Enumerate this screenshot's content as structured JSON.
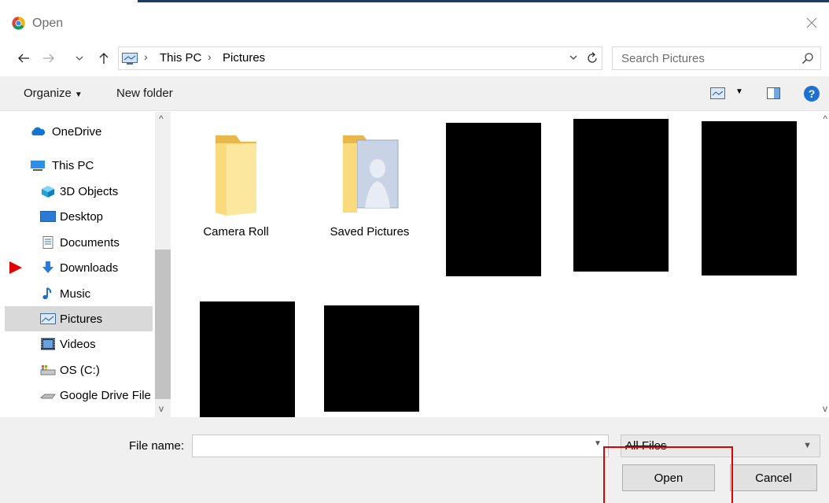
{
  "window": {
    "title": "Open",
    "icon": "chrome-icon"
  },
  "address_bar": {
    "icon": "this-pc-icon",
    "breadcrumbs": [
      "This PC",
      "Pictures"
    ],
    "search_placeholder": "Search Pictures"
  },
  "toolbar": {
    "organize_label": "Organize",
    "new_folder_label": "New folder"
  },
  "nav_pane": {
    "items": [
      {
        "label": "OneDrive",
        "icon": "onedrive-cloud-icon"
      },
      {
        "label": "This PC",
        "icon": "this-pc-icon"
      },
      {
        "label": "3D Objects",
        "icon": "3d-objects-icon"
      },
      {
        "label": "Desktop",
        "icon": "desktop-icon"
      },
      {
        "label": "Documents",
        "icon": "documents-icon"
      },
      {
        "label": "Downloads",
        "icon": "downloads-icon"
      },
      {
        "label": "Music",
        "icon": "music-icon"
      },
      {
        "label": "Pictures",
        "icon": "pictures-icon",
        "selected": true
      },
      {
        "label": "Videos",
        "icon": "videos-icon"
      },
      {
        "label": "OS (C:)",
        "icon": "drive-icon"
      },
      {
        "label": "Google Drive File",
        "icon": "google-drive-icon"
      }
    ]
  },
  "content": {
    "folders": [
      {
        "label": "Camera Roll",
        "icon": "folder-icon"
      },
      {
        "label": "Saved Pictures",
        "icon": "folder-saved-pictures-icon"
      }
    ]
  },
  "footer": {
    "file_name_label": "File name:",
    "file_name_value": "",
    "file_type_value": "All Files",
    "open_label": "Open",
    "cancel_label": "Cancel"
  }
}
